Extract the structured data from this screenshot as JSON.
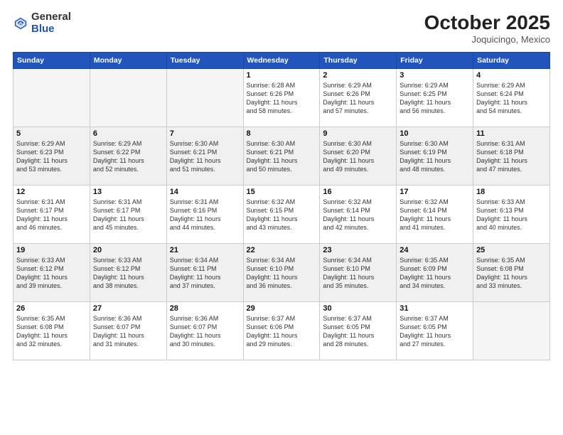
{
  "header": {
    "logo_general": "General",
    "logo_blue": "Blue",
    "month_year": "October 2025",
    "location": "Joquicingo, Mexico"
  },
  "weekdays": [
    "Sunday",
    "Monday",
    "Tuesday",
    "Wednesday",
    "Thursday",
    "Friday",
    "Saturday"
  ],
  "weeks": [
    [
      {
        "day": "",
        "info": ""
      },
      {
        "day": "",
        "info": ""
      },
      {
        "day": "",
        "info": ""
      },
      {
        "day": "1",
        "info": "Sunrise: 6:28 AM\nSunset: 6:26 PM\nDaylight: 11 hours\nand 58 minutes."
      },
      {
        "day": "2",
        "info": "Sunrise: 6:29 AM\nSunset: 6:26 PM\nDaylight: 11 hours\nand 57 minutes."
      },
      {
        "day": "3",
        "info": "Sunrise: 6:29 AM\nSunset: 6:25 PM\nDaylight: 11 hours\nand 56 minutes."
      },
      {
        "day": "4",
        "info": "Sunrise: 6:29 AM\nSunset: 6:24 PM\nDaylight: 11 hours\nand 54 minutes."
      }
    ],
    [
      {
        "day": "5",
        "info": "Sunrise: 6:29 AM\nSunset: 6:23 PM\nDaylight: 11 hours\nand 53 minutes."
      },
      {
        "day": "6",
        "info": "Sunrise: 6:29 AM\nSunset: 6:22 PM\nDaylight: 11 hours\nand 52 minutes."
      },
      {
        "day": "7",
        "info": "Sunrise: 6:30 AM\nSunset: 6:21 PM\nDaylight: 11 hours\nand 51 minutes."
      },
      {
        "day": "8",
        "info": "Sunrise: 6:30 AM\nSunset: 6:21 PM\nDaylight: 11 hours\nand 50 minutes."
      },
      {
        "day": "9",
        "info": "Sunrise: 6:30 AM\nSunset: 6:20 PM\nDaylight: 11 hours\nand 49 minutes."
      },
      {
        "day": "10",
        "info": "Sunrise: 6:30 AM\nSunset: 6:19 PM\nDaylight: 11 hours\nand 48 minutes."
      },
      {
        "day": "11",
        "info": "Sunrise: 6:31 AM\nSunset: 6:18 PM\nDaylight: 11 hours\nand 47 minutes."
      }
    ],
    [
      {
        "day": "12",
        "info": "Sunrise: 6:31 AM\nSunset: 6:17 PM\nDaylight: 11 hours\nand 46 minutes."
      },
      {
        "day": "13",
        "info": "Sunrise: 6:31 AM\nSunset: 6:17 PM\nDaylight: 11 hours\nand 45 minutes."
      },
      {
        "day": "14",
        "info": "Sunrise: 6:31 AM\nSunset: 6:16 PM\nDaylight: 11 hours\nand 44 minutes."
      },
      {
        "day": "15",
        "info": "Sunrise: 6:32 AM\nSunset: 6:15 PM\nDaylight: 11 hours\nand 43 minutes."
      },
      {
        "day": "16",
        "info": "Sunrise: 6:32 AM\nSunset: 6:14 PM\nDaylight: 11 hours\nand 42 minutes."
      },
      {
        "day": "17",
        "info": "Sunrise: 6:32 AM\nSunset: 6:14 PM\nDaylight: 11 hours\nand 41 minutes."
      },
      {
        "day": "18",
        "info": "Sunrise: 6:33 AM\nSunset: 6:13 PM\nDaylight: 11 hours\nand 40 minutes."
      }
    ],
    [
      {
        "day": "19",
        "info": "Sunrise: 6:33 AM\nSunset: 6:12 PM\nDaylight: 11 hours\nand 39 minutes."
      },
      {
        "day": "20",
        "info": "Sunrise: 6:33 AM\nSunset: 6:12 PM\nDaylight: 11 hours\nand 38 minutes."
      },
      {
        "day": "21",
        "info": "Sunrise: 6:34 AM\nSunset: 6:11 PM\nDaylight: 11 hours\nand 37 minutes."
      },
      {
        "day": "22",
        "info": "Sunrise: 6:34 AM\nSunset: 6:10 PM\nDaylight: 11 hours\nand 36 minutes."
      },
      {
        "day": "23",
        "info": "Sunrise: 6:34 AM\nSunset: 6:10 PM\nDaylight: 11 hours\nand 35 minutes."
      },
      {
        "day": "24",
        "info": "Sunrise: 6:35 AM\nSunset: 6:09 PM\nDaylight: 11 hours\nand 34 minutes."
      },
      {
        "day": "25",
        "info": "Sunrise: 6:35 AM\nSunset: 6:08 PM\nDaylight: 11 hours\nand 33 minutes."
      }
    ],
    [
      {
        "day": "26",
        "info": "Sunrise: 6:35 AM\nSunset: 6:08 PM\nDaylight: 11 hours\nand 32 minutes."
      },
      {
        "day": "27",
        "info": "Sunrise: 6:36 AM\nSunset: 6:07 PM\nDaylight: 11 hours\nand 31 minutes."
      },
      {
        "day": "28",
        "info": "Sunrise: 6:36 AM\nSunset: 6:07 PM\nDaylight: 11 hours\nand 30 minutes."
      },
      {
        "day": "29",
        "info": "Sunrise: 6:37 AM\nSunset: 6:06 PM\nDaylight: 11 hours\nand 29 minutes."
      },
      {
        "day": "30",
        "info": "Sunrise: 6:37 AM\nSunset: 6:05 PM\nDaylight: 11 hours\nand 28 minutes."
      },
      {
        "day": "31",
        "info": "Sunrise: 6:37 AM\nSunset: 6:05 PM\nDaylight: 11 hours\nand 27 minutes."
      },
      {
        "day": "",
        "info": ""
      }
    ]
  ]
}
